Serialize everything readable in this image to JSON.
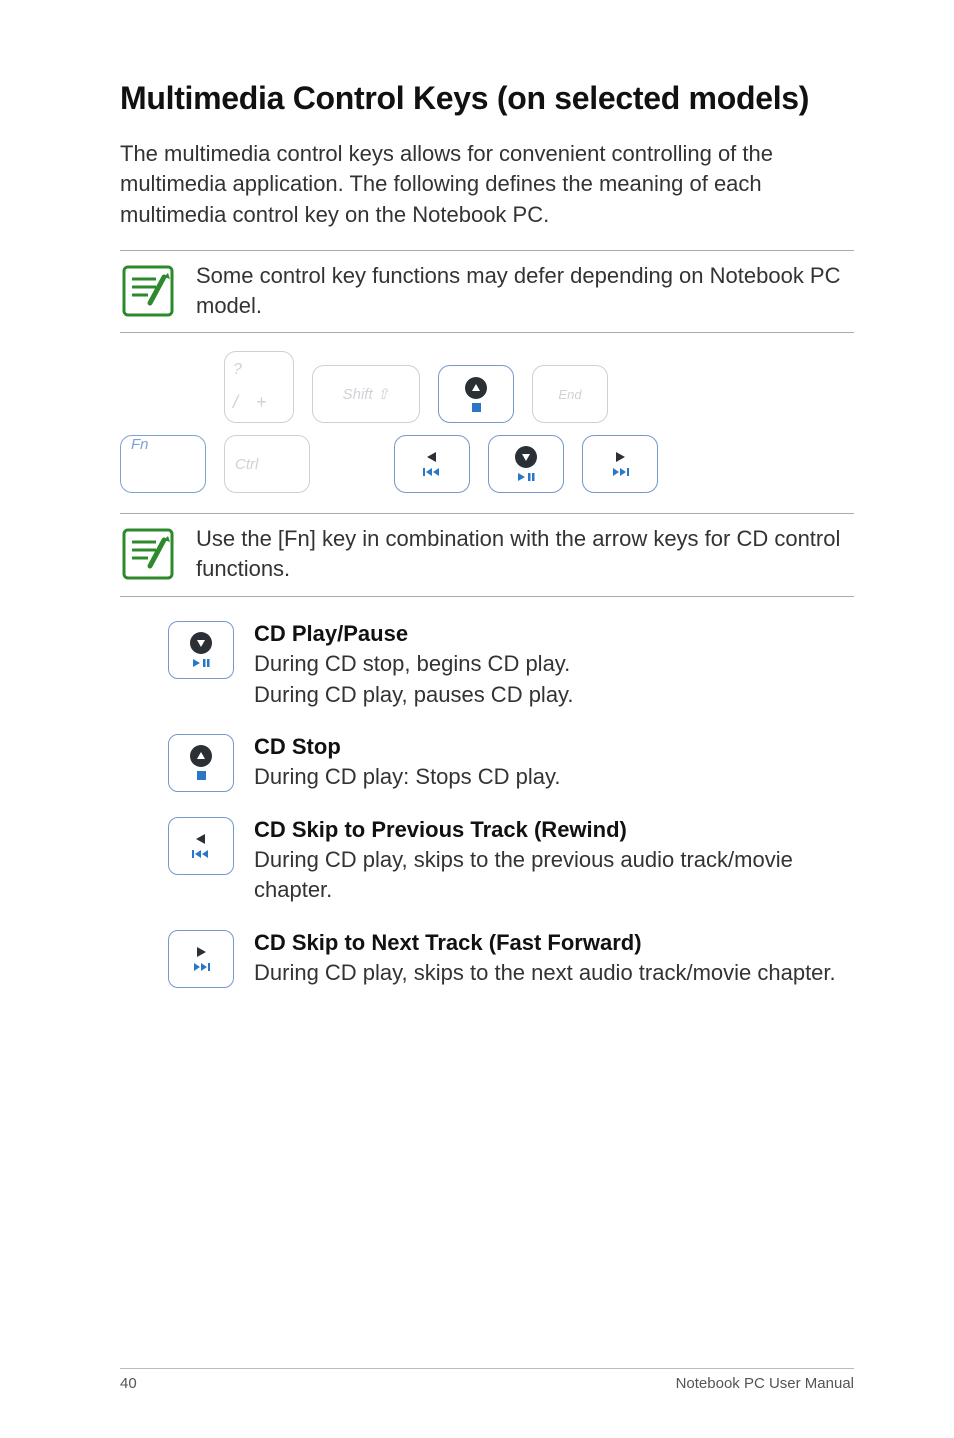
{
  "title": "Multimedia Control Keys (on selected models)",
  "intro": "The multimedia control keys allows for convenient controlling of the multimedia application. The following defines the meaning of each multimedia control key on the Notebook PC.",
  "note1": "Some control key functions may defer depending on Notebook PC model.",
  "keys": {
    "slash_top": "?",
    "slash_bot1": "/",
    "slash_bot2": "+",
    "shift": "Shift ⇧",
    "end": "End",
    "fn": "Fn",
    "ctrl": "Ctrl"
  },
  "note2": "Use the [Fn] key in combination with the arrow keys for CD control functions.",
  "funcs": {
    "play": {
      "title": "CD Play/Pause",
      "line1": "During CD stop, begins CD play.",
      "line2": "During CD play, pauses CD play."
    },
    "stop": {
      "title": "CD Stop",
      "line1": "During CD play: Stops CD play."
    },
    "prev": {
      "title": "CD Skip to Previous Track (Rewind)",
      "line1": "During CD play, skips to the previous audio track/movie chapter."
    },
    "next": {
      "title": "CD Skip to Next Track (Fast Forward)",
      "line1": "During CD play, skips to the next audio track/movie chapter."
    }
  },
  "footer": {
    "page": "40",
    "label": "Notebook PC User Manual"
  }
}
